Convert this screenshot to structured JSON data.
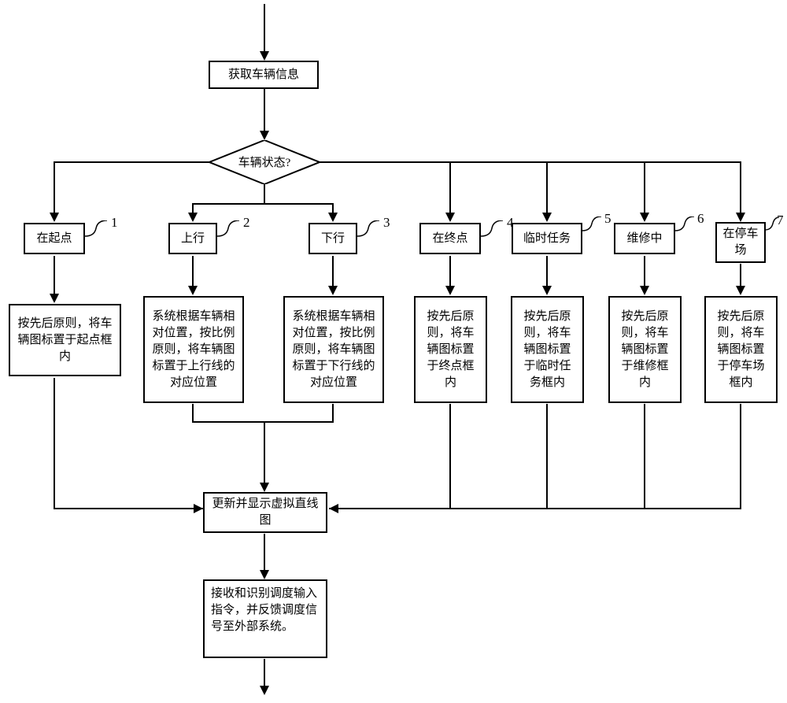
{
  "nodes": {
    "start": "获取车辆信息",
    "decision": "车辆状态?",
    "branches": [
      {
        "num": "1",
        "state": "在起点",
        "action": "按先后原则，将车辆图标置于起点框内"
      },
      {
        "num": "2",
        "state": "上行",
        "action": "系统根据车辆相对位置，按比例原则，将车辆图标置于上行线的对应位置"
      },
      {
        "num": "3",
        "state": "下行",
        "action": "系统根据车辆相对位置，按比例原则，将车辆图标置于下行线的对应位置"
      },
      {
        "num": "4",
        "state": "在终点",
        "action": "按先后原则，将车辆图标置于终点框内"
      },
      {
        "num": "5",
        "state": "临时任务",
        "action": "按先后原则，将车辆图标置于临时任务框内"
      },
      {
        "num": "6",
        "state": "维修中",
        "action": "按先后原则，将车辆图标置于维修框内"
      },
      {
        "num": "7",
        "state": "在停车场",
        "action": "按先后原则，将车辆图标置于停车场框内"
      }
    ],
    "merge": "更新并显示虚拟直线图",
    "end": "接收和识别调度输入指令，并反馈调度信号至外部系统。"
  }
}
